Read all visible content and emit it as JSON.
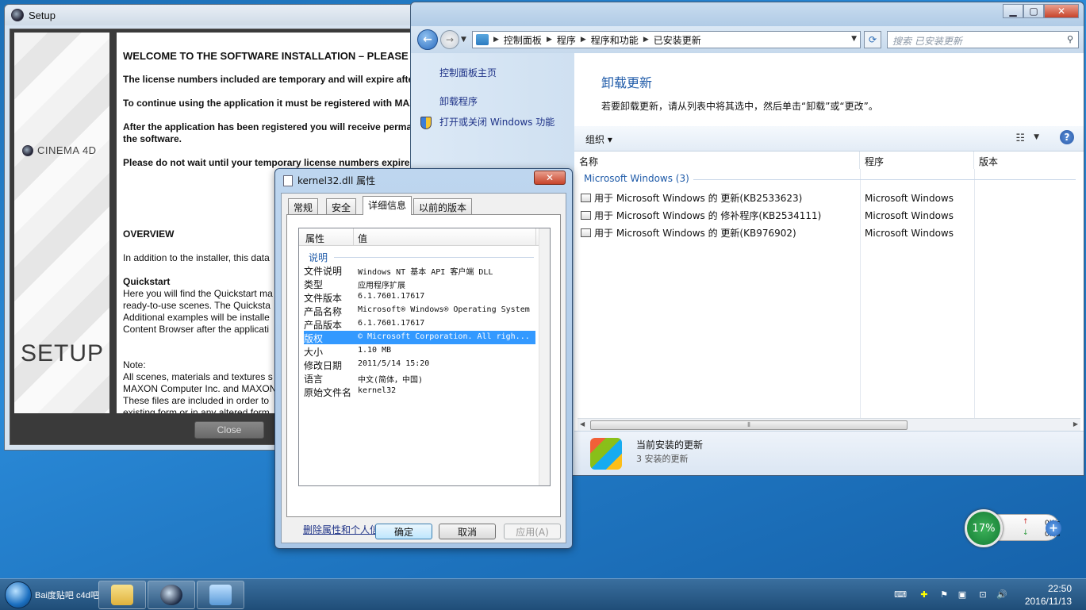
{
  "setup": {
    "title": "Setup",
    "brand": "CINEMA 4D",
    "side_title": "SETUP",
    "content": [
      {
        "text": "WELCOME TO THE SOFTWARE INSTALLATION – PLEASE",
        "style": "h"
      },
      {
        "text": "",
        "style": "gap"
      },
      {
        "text": "The license numbers included are temporary and will expire after",
        "style": "b"
      },
      {
        "text": "",
        "style": "gap"
      },
      {
        "text": "To continue using the application it must be registered with MAXON",
        "style": "b"
      },
      {
        "text": "",
        "style": "gap"
      },
      {
        "text": "After the application has been registered you will receive perma",
        "style": "b"
      },
      {
        "text": "the software.",
        "style": "b"
      },
      {
        "text": "",
        "style": "gap"
      },
      {
        "text": "Please do not wait until your temporary license numbers expire",
        "style": "b"
      },
      {
        "text": "",
        "style": "gap"
      },
      {
        "text": "",
        "style": "gap"
      },
      {
        "text": "",
        "style": "gap"
      },
      {
        "text": "",
        "style": "gap"
      },
      {
        "text": "",
        "style": "gap"
      },
      {
        "text": "OVERVIEW",
        "style": "b"
      },
      {
        "text": "",
        "style": "gap"
      },
      {
        "text": "In addition to the installer, this data",
        "style": "n"
      },
      {
        "text": "",
        "style": "gap"
      },
      {
        "text": "Quickstart",
        "style": "b"
      },
      {
        "text": "Here you will find the Quickstart ma",
        "style": "n"
      },
      {
        "text": "ready-to-use scenes. The Quicksta",
        "style": "n"
      },
      {
        "text": "Additional examples will be installe",
        "style": "n"
      },
      {
        "text": "Content Browser after the applicati",
        "style": "n"
      },
      {
        "text": "",
        "style": "gap"
      },
      {
        "text": "",
        "style": "gap"
      },
      {
        "text": "Note:",
        "style": "n"
      },
      {
        "text": "All scenes, materials and textures s",
        "style": "n"
      },
      {
        "text": "MAXON Computer Inc. and MAXON",
        "style": "n"
      },
      {
        "text": "These files are included in order to",
        "style": "n"
      },
      {
        "text": "existing form or in any altered form",
        "style": "n"
      }
    ],
    "close_label": "Close"
  },
  "control_panel": {
    "breadcrumb": [
      "控制面板",
      "程序",
      "程序和功能",
      "已安装更新"
    ],
    "search_placeholder": "搜索 已安装更新",
    "left_links": [
      "控制面板主页",
      "卸载程序",
      "打开或关闭 Windows 功能"
    ],
    "heading": "卸载更新",
    "description": "若要卸载更新，请从列表中将其选中，然后单击“卸载”或“更改”。",
    "organize_label": "组织",
    "columns": [
      "名称",
      "程序",
      "版本"
    ],
    "group_label": "Microsoft Windows (3)",
    "updates": [
      {
        "name": "用于 Microsoft Windows 的 更新(KB2533623)",
        "program": "Microsoft Windows"
      },
      {
        "name": "用于 Microsoft Windows 的 修补程序(KB2534111)",
        "program": "Microsoft Windows"
      },
      {
        "name": "用于 Microsoft Windows 的 更新(KB976902)",
        "program": "Microsoft Windows"
      }
    ],
    "status_title": "当前安装的更新",
    "status_sub": "3 安装的更新"
  },
  "dialog": {
    "title": "kernel32.dll 属性",
    "tabs": [
      "常规",
      "安全",
      "详细信息",
      "以前的版本"
    ],
    "active_tab": "详细信息",
    "list_headers": [
      "属性",
      "值"
    ],
    "section": "说明",
    "properties": [
      {
        "name": "文件说明",
        "value": "Windows NT 基本 API 客户端 DLL"
      },
      {
        "name": "类型",
        "value": "应用程序扩展"
      },
      {
        "name": "文件版本",
        "value": "6.1.7601.17617"
      },
      {
        "name": "产品名称",
        "value": "Microsoft® Windows® Operating System"
      },
      {
        "name": "产品版本",
        "value": "6.1.7601.17617"
      },
      {
        "name": "版权",
        "value": "© Microsoft Corporation. All righ..."
      },
      {
        "name": "大小",
        "value": "1.10 MB"
      },
      {
        "name": "修改日期",
        "value": "2011/5/14 15:20"
      },
      {
        "name": "语言",
        "value": "中文(简体，中国)"
      },
      {
        "name": "原始文件名",
        "value": "kernel32"
      }
    ],
    "selected_property": "版权",
    "remove_link": "删除属性和个人信息",
    "ok_label": "确定",
    "cancel_label": "取消",
    "apply_label": "应用(A)"
  },
  "gadget": {
    "percent": "17%",
    "upload": "0K/s",
    "download": "0K/s"
  },
  "taskbar": {
    "start_text": "Bai度贴吧 c4d吧",
    "time": "22:50",
    "date": "2016/11/13"
  },
  "colors": {
    "accent": "#1e5aa8",
    "selection": "#3399ff",
    "link": "#1e3287"
  }
}
